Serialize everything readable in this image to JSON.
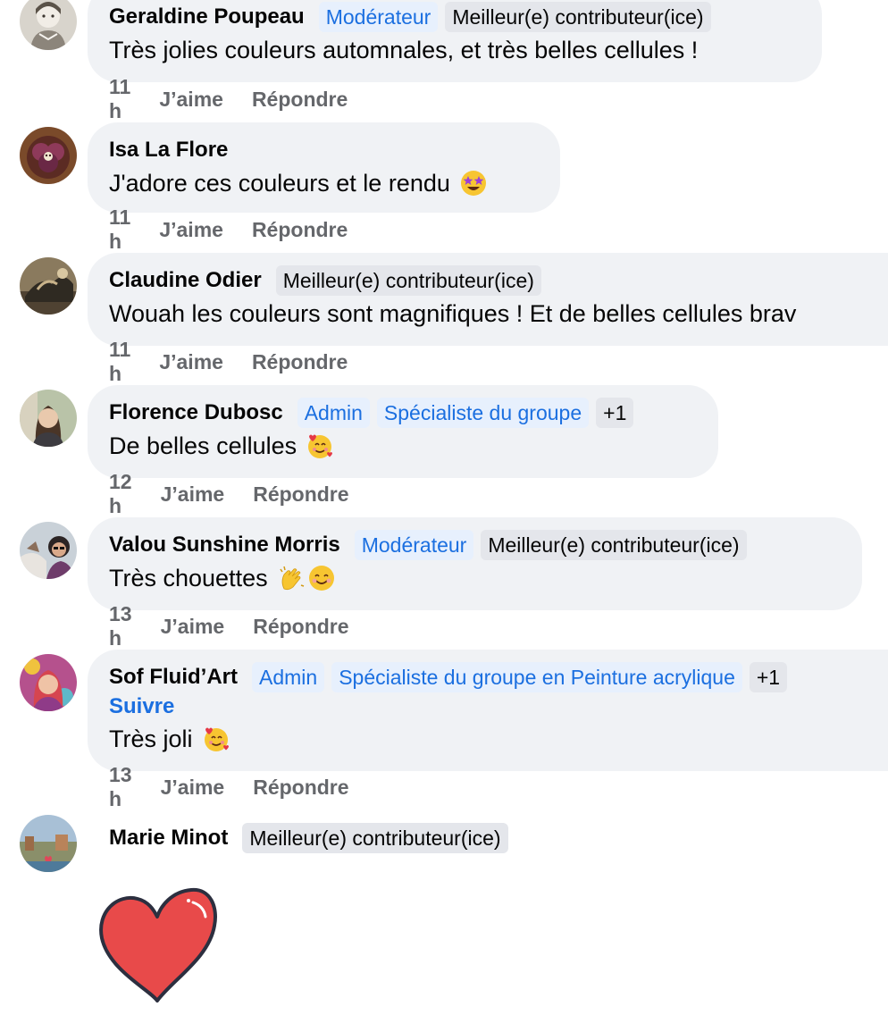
{
  "labels": {
    "like": "J’aime",
    "reply": "Répondre"
  },
  "comments": [
    {
      "author": "Geraldine Poupeau",
      "badges": [
        "Modérateur",
        "Meilleur(e) contributeur(ice)"
      ],
      "text": "Très jolies couleurs automnales, et très belles cellules !",
      "time": "11 h"
    },
    {
      "author": "Isa La Flore",
      "badges": [],
      "text": "J'adore ces couleurs et le rendu",
      "emoji": [
        "star-struck-emoji"
      ],
      "time": "11 h"
    },
    {
      "author": "Claudine Odier",
      "badges": [
        "Meilleur(e) contributeur(ice)"
      ],
      "text": "Wouah les couleurs sont magnifiques ! Et de belles cellules brav",
      "time": "11 h"
    },
    {
      "author": "Florence Dubosc",
      "badges": [
        "Admin",
        "Spécialiste du groupe",
        "+1"
      ],
      "text": "De belles cellules",
      "emoji": [
        "smiling-face-with-hearts-emoji"
      ],
      "time": "12 h"
    },
    {
      "author": "Valou Sunshine Morris",
      "badges": [
        "Modérateur",
        "Meilleur(e) contributeur(ice)"
      ],
      "text": "Très chouettes",
      "emoji": [
        "clapping-hands-emoji",
        "smiling-face-emoji"
      ],
      "time": "13 h"
    },
    {
      "author": "Sof Fluid’Art",
      "badges": [
        "Admin",
        "Spécialiste du groupe en Peinture acrylique",
        "+1"
      ],
      "follow": "Suivre",
      "text": "Très joli",
      "emoji": [
        "smiling-face-with-hearts-emoji"
      ],
      "time": "13 h"
    },
    {
      "author": "Marie Minot",
      "badges": [
        "Meilleur(e) contributeur(ice)"
      ],
      "sticker": "red-heart-sticker"
    }
  ]
}
